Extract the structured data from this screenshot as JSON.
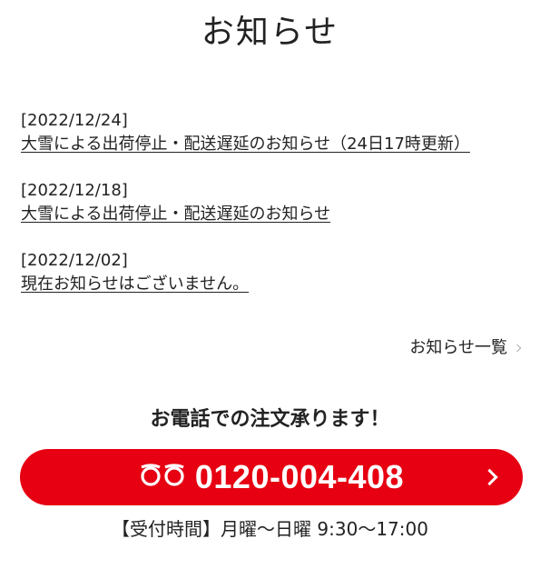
{
  "page": {
    "title": "お知らせ"
  },
  "news": {
    "items": [
      {
        "date": "[2022/12/24]",
        "text": "大雪による出荷停止・配送遅延のお知らせ（24日17時更新）"
      },
      {
        "date": "[2022/12/18]",
        "text": "大雪による出荷停止・配送遅延のお知らせ"
      },
      {
        "date": "[2022/12/02]",
        "text": "現在お知らせはございません。"
      }
    ],
    "more_label": "お知らせ一覧"
  },
  "contact": {
    "heading": "お電話での注文承ります！",
    "phone_number": "0120-004-408",
    "hours": "【受付時間】月曜〜日曜 9:30〜17:00",
    "button_color": "#e60012"
  },
  "icons": {
    "freedial": "freedial-icon",
    "chevron": "chevron-right-icon"
  }
}
